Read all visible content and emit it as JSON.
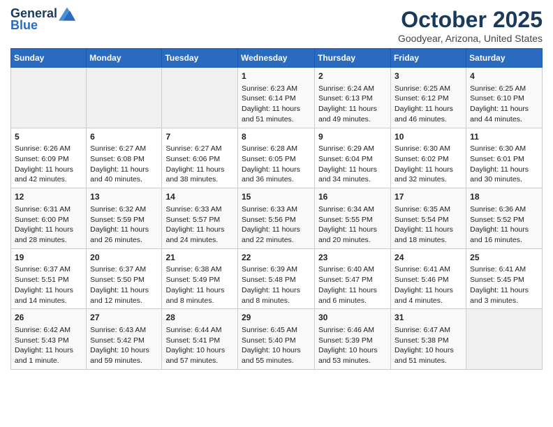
{
  "header": {
    "logo_line1": "General",
    "logo_line2": "Blue",
    "month": "October 2025",
    "location": "Goodyear, Arizona, United States"
  },
  "weekdays": [
    "Sunday",
    "Monday",
    "Tuesday",
    "Wednesday",
    "Thursday",
    "Friday",
    "Saturday"
  ],
  "weeks": [
    [
      {
        "day": "",
        "sunrise": "",
        "sunset": "",
        "daylight": ""
      },
      {
        "day": "",
        "sunrise": "",
        "sunset": "",
        "daylight": ""
      },
      {
        "day": "",
        "sunrise": "",
        "sunset": "",
        "daylight": ""
      },
      {
        "day": "1",
        "sunrise": "Sunrise: 6:23 AM",
        "sunset": "Sunset: 6:14 PM",
        "daylight": "Daylight: 11 hours and 51 minutes."
      },
      {
        "day": "2",
        "sunrise": "Sunrise: 6:24 AM",
        "sunset": "Sunset: 6:13 PM",
        "daylight": "Daylight: 11 hours and 49 minutes."
      },
      {
        "day": "3",
        "sunrise": "Sunrise: 6:25 AM",
        "sunset": "Sunset: 6:12 PM",
        "daylight": "Daylight: 11 hours and 46 minutes."
      },
      {
        "day": "4",
        "sunrise": "Sunrise: 6:25 AM",
        "sunset": "Sunset: 6:10 PM",
        "daylight": "Daylight: 11 hours and 44 minutes."
      }
    ],
    [
      {
        "day": "5",
        "sunrise": "Sunrise: 6:26 AM",
        "sunset": "Sunset: 6:09 PM",
        "daylight": "Daylight: 11 hours and 42 minutes."
      },
      {
        "day": "6",
        "sunrise": "Sunrise: 6:27 AM",
        "sunset": "Sunset: 6:08 PM",
        "daylight": "Daylight: 11 hours and 40 minutes."
      },
      {
        "day": "7",
        "sunrise": "Sunrise: 6:27 AM",
        "sunset": "Sunset: 6:06 PM",
        "daylight": "Daylight: 11 hours and 38 minutes."
      },
      {
        "day": "8",
        "sunrise": "Sunrise: 6:28 AM",
        "sunset": "Sunset: 6:05 PM",
        "daylight": "Daylight: 11 hours and 36 minutes."
      },
      {
        "day": "9",
        "sunrise": "Sunrise: 6:29 AM",
        "sunset": "Sunset: 6:04 PM",
        "daylight": "Daylight: 11 hours and 34 minutes."
      },
      {
        "day": "10",
        "sunrise": "Sunrise: 6:30 AM",
        "sunset": "Sunset: 6:02 PM",
        "daylight": "Daylight: 11 hours and 32 minutes."
      },
      {
        "day": "11",
        "sunrise": "Sunrise: 6:30 AM",
        "sunset": "Sunset: 6:01 PM",
        "daylight": "Daylight: 11 hours and 30 minutes."
      }
    ],
    [
      {
        "day": "12",
        "sunrise": "Sunrise: 6:31 AM",
        "sunset": "Sunset: 6:00 PM",
        "daylight": "Daylight: 11 hours and 28 minutes."
      },
      {
        "day": "13",
        "sunrise": "Sunrise: 6:32 AM",
        "sunset": "Sunset: 5:59 PM",
        "daylight": "Daylight: 11 hours and 26 minutes."
      },
      {
        "day": "14",
        "sunrise": "Sunrise: 6:33 AM",
        "sunset": "Sunset: 5:57 PM",
        "daylight": "Daylight: 11 hours and 24 minutes."
      },
      {
        "day": "15",
        "sunrise": "Sunrise: 6:33 AM",
        "sunset": "Sunset: 5:56 PM",
        "daylight": "Daylight: 11 hours and 22 minutes."
      },
      {
        "day": "16",
        "sunrise": "Sunrise: 6:34 AM",
        "sunset": "Sunset: 5:55 PM",
        "daylight": "Daylight: 11 hours and 20 minutes."
      },
      {
        "day": "17",
        "sunrise": "Sunrise: 6:35 AM",
        "sunset": "Sunset: 5:54 PM",
        "daylight": "Daylight: 11 hours and 18 minutes."
      },
      {
        "day": "18",
        "sunrise": "Sunrise: 6:36 AM",
        "sunset": "Sunset: 5:52 PM",
        "daylight": "Daylight: 11 hours and 16 minutes."
      }
    ],
    [
      {
        "day": "19",
        "sunrise": "Sunrise: 6:37 AM",
        "sunset": "Sunset: 5:51 PM",
        "daylight": "Daylight: 11 hours and 14 minutes."
      },
      {
        "day": "20",
        "sunrise": "Sunrise: 6:37 AM",
        "sunset": "Sunset: 5:50 PM",
        "daylight": "Daylight: 11 hours and 12 minutes."
      },
      {
        "day": "21",
        "sunrise": "Sunrise: 6:38 AM",
        "sunset": "Sunset: 5:49 PM",
        "daylight": "Daylight: 11 hours and 8 minutes."
      },
      {
        "day": "22",
        "sunrise": "Sunrise: 6:39 AM",
        "sunset": "Sunset: 5:48 PM",
        "daylight": "Daylight: 11 hours and 8 minutes."
      },
      {
        "day": "23",
        "sunrise": "Sunrise: 6:40 AM",
        "sunset": "Sunset: 5:47 PM",
        "daylight": "Daylight: 11 hours and 6 minutes."
      },
      {
        "day": "24",
        "sunrise": "Sunrise: 6:41 AM",
        "sunset": "Sunset: 5:46 PM",
        "daylight": "Daylight: 11 hours and 4 minutes."
      },
      {
        "day": "25",
        "sunrise": "Sunrise: 6:41 AM",
        "sunset": "Sunset: 5:45 PM",
        "daylight": "Daylight: 11 hours and 3 minutes."
      }
    ],
    [
      {
        "day": "26",
        "sunrise": "Sunrise: 6:42 AM",
        "sunset": "Sunset: 5:43 PM",
        "daylight": "Daylight: 11 hours and 1 minute."
      },
      {
        "day": "27",
        "sunrise": "Sunrise: 6:43 AM",
        "sunset": "Sunset: 5:42 PM",
        "daylight": "Daylight: 10 hours and 59 minutes."
      },
      {
        "day": "28",
        "sunrise": "Sunrise: 6:44 AM",
        "sunset": "Sunset: 5:41 PM",
        "daylight": "Daylight: 10 hours and 57 minutes."
      },
      {
        "day": "29",
        "sunrise": "Sunrise: 6:45 AM",
        "sunset": "Sunset: 5:40 PM",
        "daylight": "Daylight: 10 hours and 55 minutes."
      },
      {
        "day": "30",
        "sunrise": "Sunrise: 6:46 AM",
        "sunset": "Sunset: 5:39 PM",
        "daylight": "Daylight: 10 hours and 53 minutes."
      },
      {
        "day": "31",
        "sunrise": "Sunrise: 6:47 AM",
        "sunset": "Sunset: 5:38 PM",
        "daylight": "Daylight: 10 hours and 51 minutes."
      },
      {
        "day": "",
        "sunrise": "",
        "sunset": "",
        "daylight": ""
      }
    ]
  ]
}
